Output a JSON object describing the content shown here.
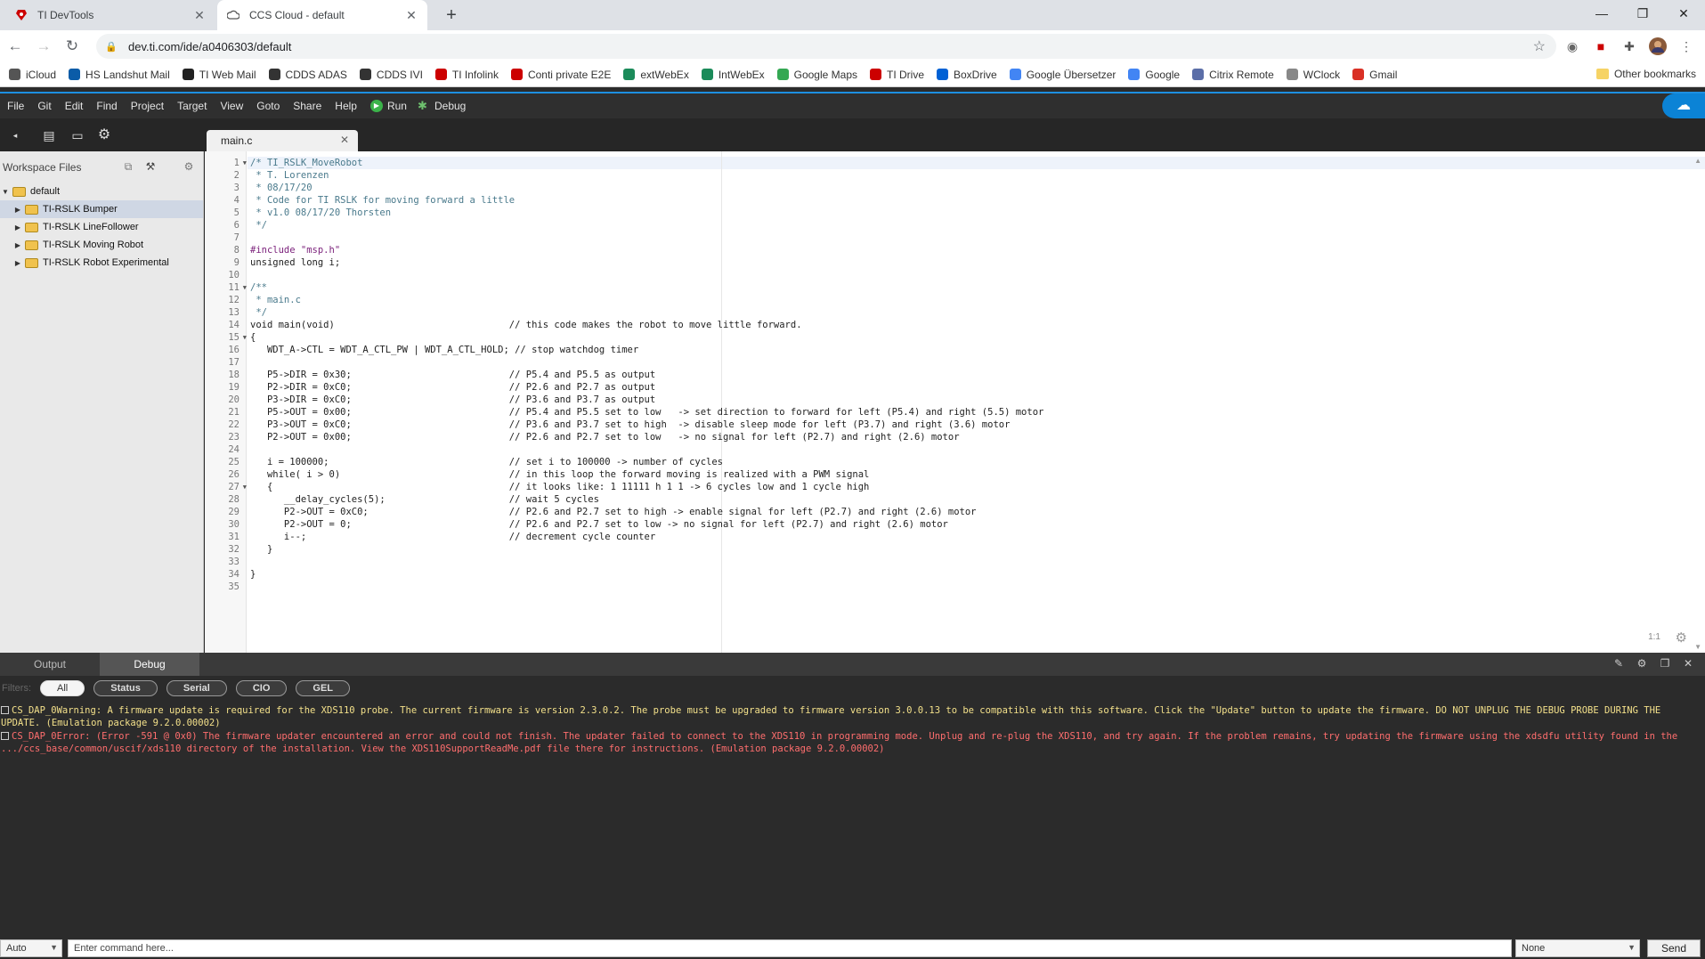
{
  "browser": {
    "tabs": [
      {
        "title": "TI DevTools"
      },
      {
        "title": "CCS Cloud - default"
      }
    ],
    "url": "dev.ti.com/ide/a0406303/default",
    "bookmarks": [
      {
        "label": "iCloud",
        "color": "#555555"
      },
      {
        "label": "HS Landshut Mail",
        "color": "#0b5ca8"
      },
      {
        "label": "TI Web Mail",
        "color": "#222222"
      },
      {
        "label": "CDDS ADAS",
        "color": "#333333"
      },
      {
        "label": "CDDS IVI",
        "color": "#333333"
      },
      {
        "label": "TI Infolink",
        "color": "#cc0000"
      },
      {
        "label": "Conti private E2E",
        "color": "#cc0000"
      },
      {
        "label": "extWebEx",
        "color": "#1b8b5a"
      },
      {
        "label": "IntWebEx",
        "color": "#1b8b5a"
      },
      {
        "label": "Google Maps",
        "color": "#34a853"
      },
      {
        "label": "TI Drive",
        "color": "#cc0000"
      },
      {
        "label": "BoxDrive",
        "color": "#0061d5"
      },
      {
        "label": "Google Übersetzer",
        "color": "#4285f4"
      },
      {
        "label": "Google",
        "color": "#4285f4"
      },
      {
        "label": "Citrix Remote",
        "color": "#5b6ea8"
      },
      {
        "label": "WClock",
        "color": "#888888"
      },
      {
        "label": "Gmail",
        "color": "#d93025"
      }
    ],
    "other_bookmarks": "Other bookmarks"
  },
  "ide": {
    "menu": [
      "File",
      "Git",
      "Edit",
      "Find",
      "Project",
      "Target",
      "View",
      "Goto",
      "Share",
      "Help"
    ],
    "run_label": "Run",
    "debug_label": "Debug",
    "editor_tab": "main.c",
    "workspace_title": "Workspace Files",
    "tree": {
      "root": "default",
      "projects": [
        "TI-RSLK Bumper",
        "TI-RSLK LineFollower",
        "TI-RSLK Moving Robot",
        "TI-RSLK Robot Experimental"
      ]
    },
    "cursor_position": "1:1"
  },
  "code": [
    "/* TI_RSLK_MoveRobot",
    " * T. Lorenzen",
    " * 08/17/20",
    " * Code for TI RSLK for moving forward a little",
    " * v1.0 08/17/20 Thorsten",
    " */",
    "",
    "#include \"msp.h\"",
    "unsigned long i;",
    "",
    "/**",
    " * main.c",
    " */",
    "void main(void)                               // this code makes the robot to move little forward.",
    "{",
    "   WDT_A->CTL = WDT_A_CTL_PW | WDT_A_CTL_HOLD; // stop watchdog timer",
    "",
    "   P5->DIR = 0x30;                            // P5.4 and P5.5 as output",
    "   P2->DIR = 0xC0;                            // P2.6 and P2.7 as output",
    "   P3->DIR = 0xC0;                            // P3.6 and P3.7 as output",
    "   P5->OUT = 0x00;                            // P5.4 and P5.5 set to low   -> set direction to forward for left (P5.4) and right (5.5) motor",
    "   P3->OUT = 0xC0;                            // P3.6 and P3.7 set to high  -> disable sleep mode for left (P3.7) and right (3.6) motor",
    "   P2->OUT = 0x00;                            // P2.6 and P2.7 set to low   -> no signal for left (P2.7) and right (2.6) motor",
    "",
    "   i = 100000;                                // set i to 100000 -> number of cycles",
    "   while( i > 0)                              // in this loop the forward moving is realized with a PWM signal",
    "   {                                          // it looks like: 1 11111 h 1 1 -> 6 cycles low and 1 cycle high",
    "      __delay_cycles(5);                      // wait 5 cycles",
    "      P2->OUT = 0xC0;                         // P2.6 and P2.7 set to high -> enable signal for left (P2.7) and right (2.6) motor",
    "      P2->OUT = 0;                            // P2.6 and P2.7 set to low -> no signal for left (P2.7) and right (2.6) motor",
    "      i--;                                    // decrement cycle counter",
    "   }",
    "",
    "}",
    ""
  ],
  "console": {
    "tabs": [
      "Output",
      "Debug"
    ],
    "filters_label": "Filters:",
    "filters": [
      "All",
      "Status",
      "Serial",
      "CIO",
      "GEL"
    ],
    "messages": [
      {
        "level": "warning",
        "text": "CS_DAP_0Warning: A firmware update is required for the XDS110 probe. The current firmware is version 2.3.0.2. The probe must be upgraded to firmware version 3.0.0.13 to be compatible with this software. Click the \"Update\" button to update the firmware. DO NOT UNPLUG THE DEBUG PROBE DURING THE UPDATE. (Emulation package 9.2.0.00002)"
      },
      {
        "level": "error",
        "text": "CS_DAP_0Error: (Error -591 @ 0x0) The firmware updater encountered an error and could not finish. The updater failed to connect to the XDS110 in programming mode. Unplug and re-plug the XDS110, and try again. If the problem remains, try updating the firmware using the xdsdfu utility found in the .../ccs_base/common/uscif/xds110 directory of the installation. View the XDS110SupportReadMe.pdf file there for instructions. (Emulation package 9.2.0.00002)"
      }
    ],
    "mode_select": "Auto",
    "command_placeholder": "Enter command here...",
    "target_select": "None",
    "send_label": "Send"
  }
}
